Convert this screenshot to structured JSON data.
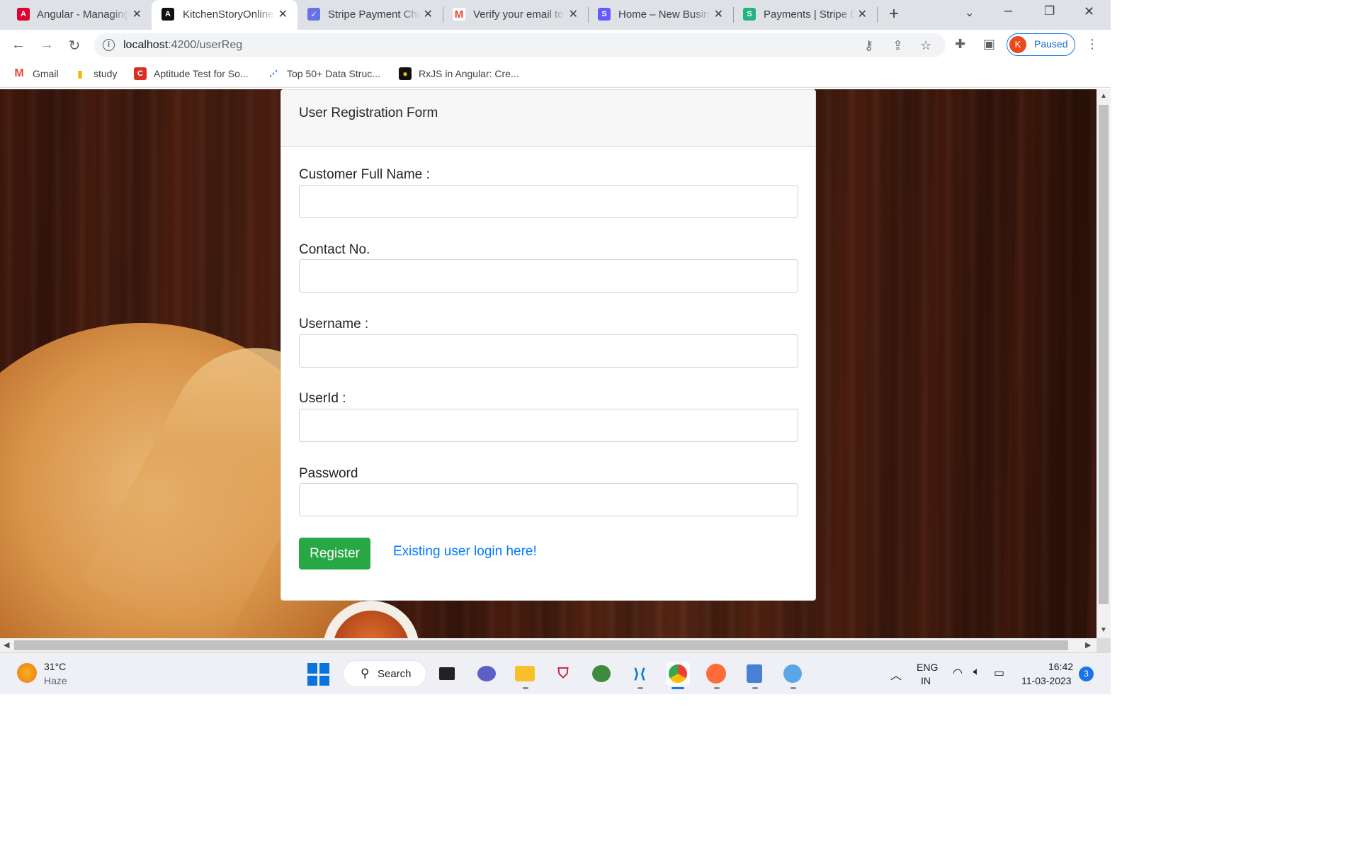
{
  "browser": {
    "tabs": [
      {
        "title": "Angular - Managing",
        "icon": "angular-icon",
        "active": false
      },
      {
        "title": "KitchenStoryOnline",
        "icon": "angular-icon",
        "active": true
      },
      {
        "title": "Stripe Payment Che",
        "icon": "stripe-checkout-icon",
        "active": false
      },
      {
        "title": "Verify your email to",
        "icon": "gmail-icon",
        "active": false
      },
      {
        "title": "Home – New Busine",
        "icon": "stripe-icon",
        "active": false
      },
      {
        "title": "Payments | Stripe D",
        "icon": "stripe-green-icon",
        "active": false
      }
    ],
    "new_tab": "+",
    "url_host": "localhost",
    "url_path": ":4200/userReg",
    "profile_initial": "K",
    "profile_status": "Paused",
    "bookmarks": [
      {
        "label": "Gmail",
        "icon": "gmail-icon"
      },
      {
        "label": "study",
        "icon": "chart-icon"
      },
      {
        "label": "Aptitude Test for So...",
        "icon": "c-icon"
      },
      {
        "label": "Top 50+ Data Struc...",
        "icon": "ds-icon"
      },
      {
        "label": "RxJS in Angular: Cre...",
        "icon": "bulb-icon"
      }
    ]
  },
  "form": {
    "title": "User Registration Form",
    "fields": [
      {
        "label": "Customer Full Name :",
        "value": ""
      },
      {
        "label": "Contact No.",
        "value": ""
      },
      {
        "label": "Username :",
        "value": ""
      },
      {
        "label": "UserId :",
        "value": ""
      },
      {
        "label": "Password",
        "value": ""
      }
    ],
    "register_label": "Register",
    "login_link": "Existing user login here!"
  },
  "taskbar": {
    "weather_temp": "31°C",
    "weather_desc": "Haze",
    "search_label": "Search",
    "lang_top": "ENG",
    "lang_bottom": "IN",
    "time": "16:42",
    "date": "11-03-2023",
    "notifications": "3"
  },
  "colors": {
    "register_button": "#28a745",
    "link": "#007bff",
    "profile_border": "#1a73e8"
  }
}
